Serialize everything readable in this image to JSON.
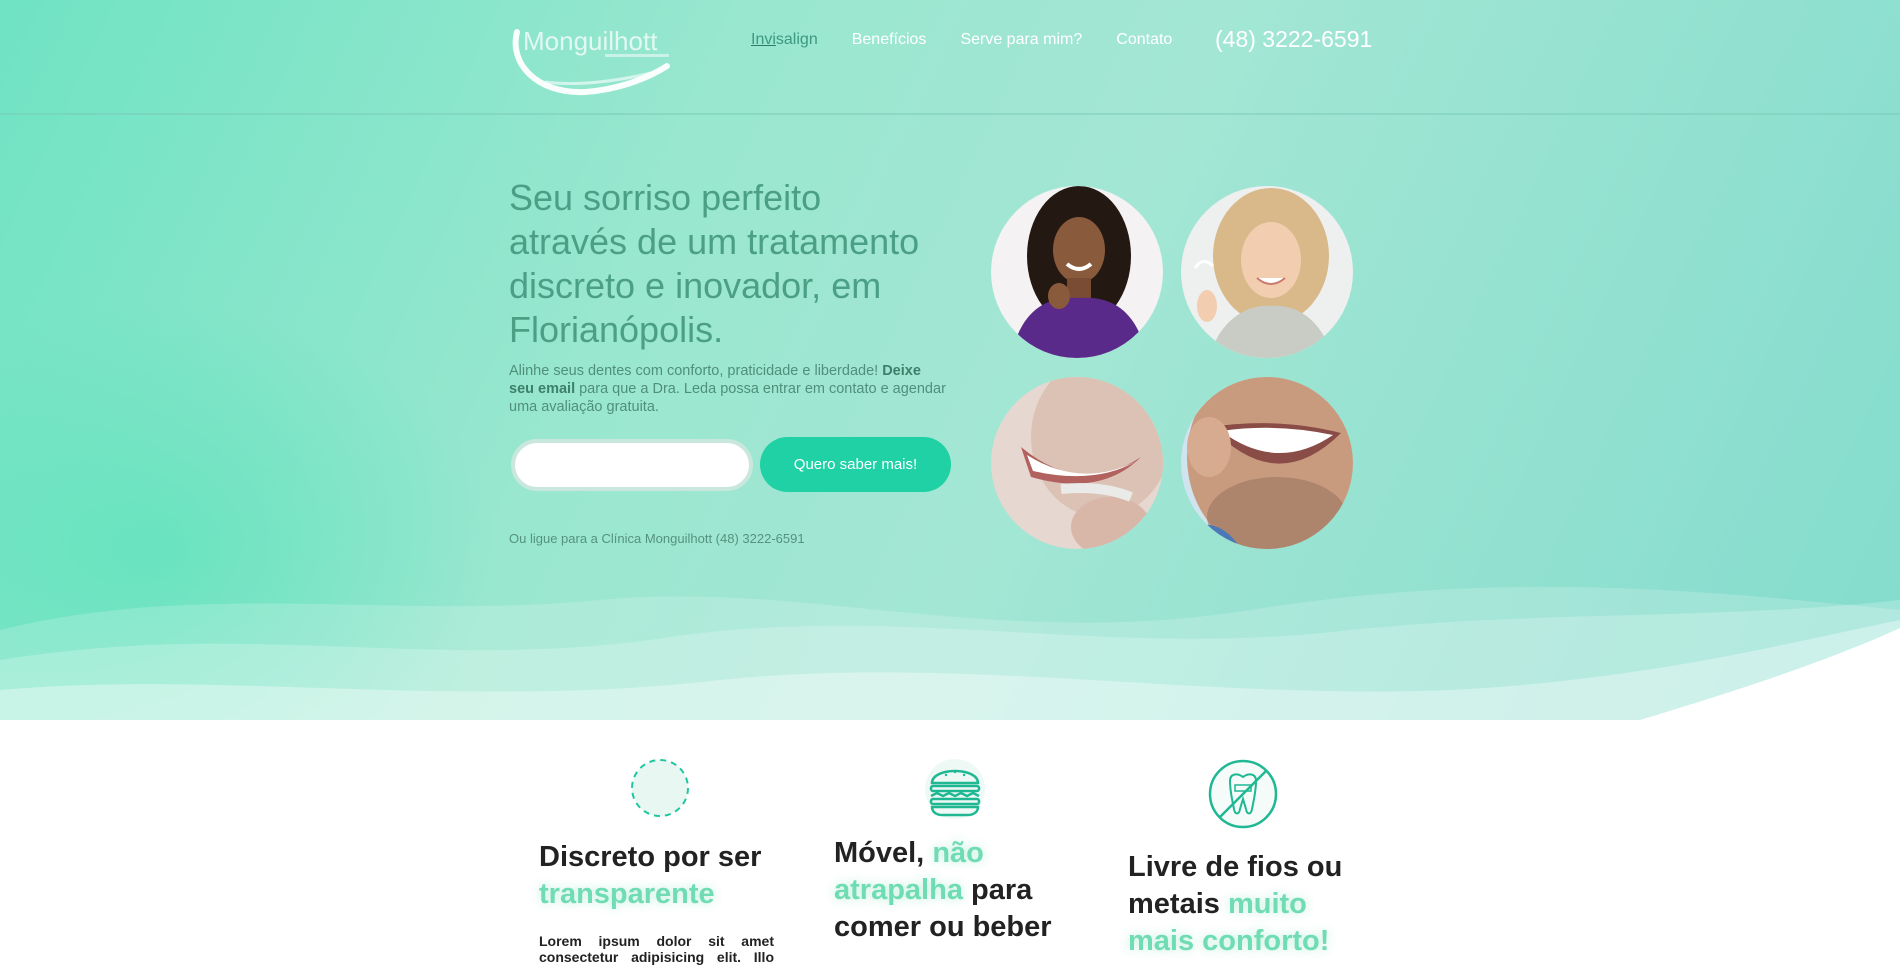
{
  "header": {
    "logo_text": "Monguilhott",
    "nav": [
      {
        "label_underlined": "Invi",
        "label_rest": "salign"
      },
      {
        "label": "Benefícios"
      },
      {
        "label": "Serve para mim?"
      },
      {
        "label": "Contato"
      }
    ],
    "phone": "(48) 3222-6591"
  },
  "hero": {
    "headline": "Seu sorriso perfeito através de um tratamento discreto e inovador, em Florianópolis.",
    "lead_part1": "Alinhe seus dentes com conforto, praticidade e liberdade! ",
    "lead_bold": "Deixe seu email",
    "lead_part2": " para que a Dra. Leda possa entrar em contato e agendar uma avaliação gratuita.",
    "email_placeholder": "",
    "cta_label": "Quero saber mais!",
    "call_line": "Ou ligue para a Clínica Monguilhott (48) 3222-6591"
  },
  "features": [
    {
      "title_plain": "Discreto por ser ",
      "title_highlight": "transparente",
      "text": "Lorem ipsum dolor sit amet consectetur adipisicing elit. Illo sunt"
    },
    {
      "title_plain_1": "Móvel, ",
      "title_highlight": "não atrapalha",
      "title_plain_2": " para comer ou beber"
    },
    {
      "title_plain": "Livre de fios ou metais ",
      "title_highlight": "muito mais conforto!"
    }
  ],
  "icons": [
    "circle-dashed-icon",
    "burger-icon",
    "no-braces-tooth-icon"
  ],
  "colors": {
    "accent": "#1fd1a5",
    "highlight": "#6fdcb4",
    "headline": "#4a9f84"
  }
}
